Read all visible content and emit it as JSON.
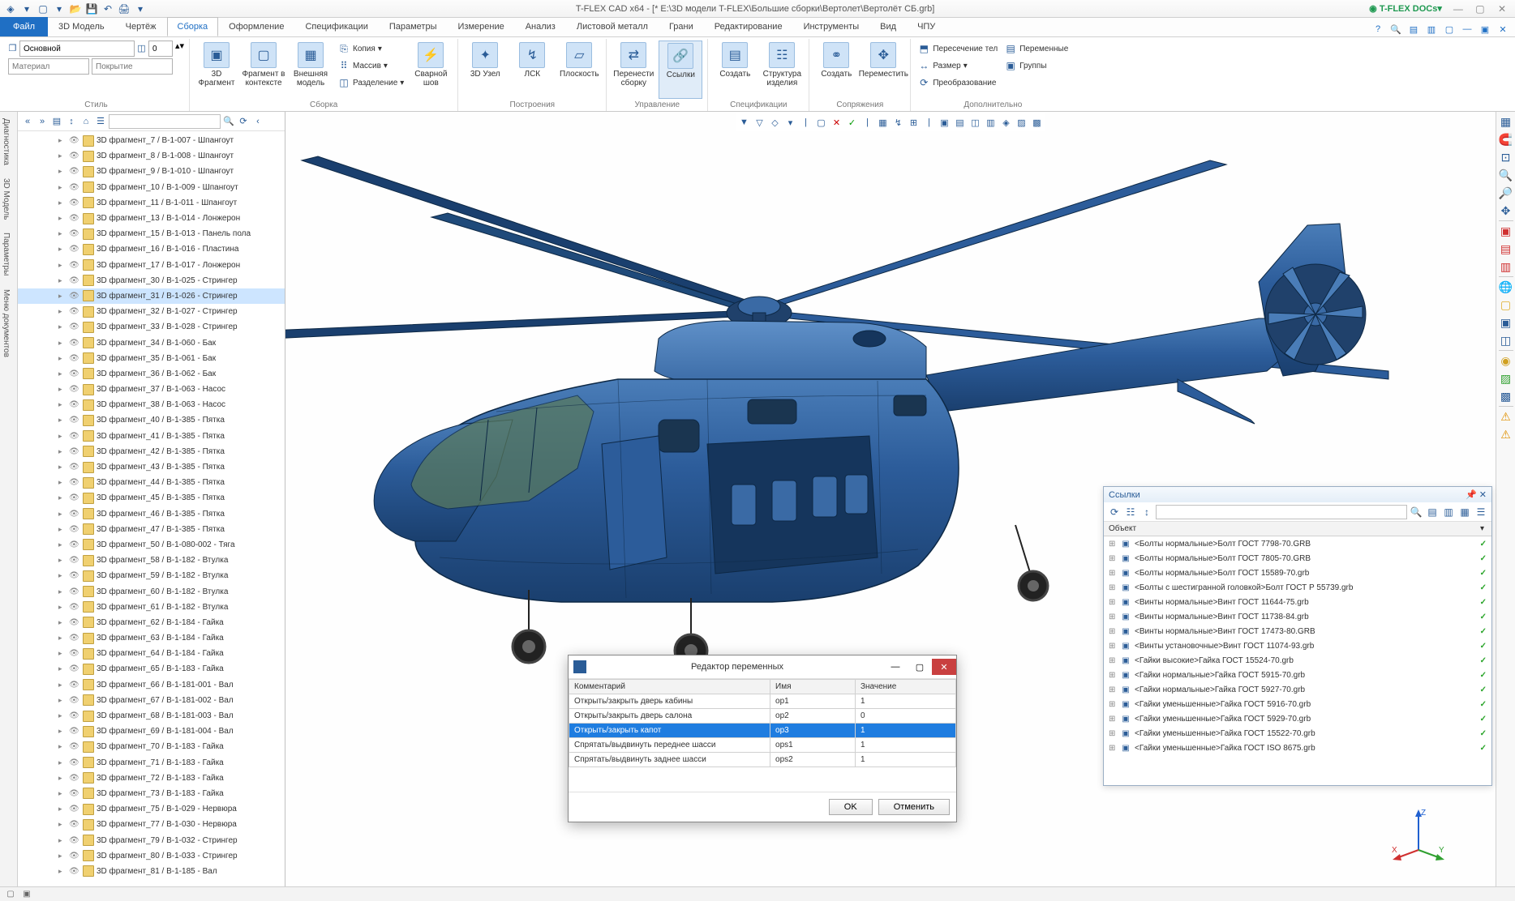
{
  "app": {
    "title": "T-FLEX CAD x64 - [* E:\\3D модели T-FLEX\\Большие сборки\\Вертолет\\Вертолёт СБ.grb]",
    "docs_link": "T-FLEX DOCs"
  },
  "ribbon_tabs": {
    "file": "Файл",
    "tabs": [
      "3D Модель",
      "Чертёж",
      "Сборка",
      "Оформление",
      "Спецификации",
      "Параметры",
      "Измерение",
      "Анализ",
      "Листовой металл",
      "Грани",
      "Редактирование",
      "Инструменты",
      "Вид",
      "ЧПУ"
    ],
    "active": "Сборка"
  },
  "ribbon": {
    "style": {
      "main_input": "Основной",
      "num_input": "0",
      "material": "Материал",
      "coating": "Покрытие",
      "title": "Стиль"
    },
    "groups": {
      "sborka": {
        "big": [
          {
            "label": "3D Фрагмент"
          },
          {
            "label": "Фрагмент в контексте"
          },
          {
            "label": "Внешняя модель"
          }
        ],
        "small": [
          "Копия",
          "Массив",
          "Разделение"
        ],
        "weld": "Сварной шов",
        "title": "Сборка"
      },
      "postroenia": {
        "big": [
          {
            "label": "3D Узел"
          },
          {
            "label": "ЛСК"
          },
          {
            "label": "Плоскость"
          }
        ],
        "title": "Построения"
      },
      "upravlenie": {
        "big": [
          {
            "label": "Перенести сборку"
          },
          {
            "label": "Ссылки"
          }
        ],
        "title": "Управление"
      },
      "spec": {
        "big": [
          {
            "label": "Создать"
          },
          {
            "label": "Структура изделия"
          }
        ],
        "title": "Спецификации"
      },
      "sopr": {
        "big": [
          {
            "label": "Создать"
          },
          {
            "label": "Переместить"
          }
        ],
        "title": "Сопряжения"
      },
      "dop": {
        "small": [
          "Пересечение тел",
          "Размер",
          "Преобразование",
          "Переменные",
          "Группы"
        ],
        "title": "Дополнительно"
      }
    }
  },
  "left_vtabs": [
    "Диагностика",
    "3D Модель",
    "Параметры",
    "Меню документов"
  ],
  "tree": [
    "3D фрагмент_7 / B-1-007 - Шпангоут",
    "3D фрагмент_8 / B-1-008 - Шпангоут",
    "3D фрагмент_9 / B-1-010 - Шпангоут",
    "3D фрагмент_10 / B-1-009 - Шпангоут",
    "3D фрагмент_11 / B-1-011 - Шпангоут",
    "3D фрагмент_13 / B-1-014 - Лонжерон",
    "3D фрагмент_15 / B-1-013 - Панель пола",
    "3D фрагмент_16 / B-1-016 - Пластина",
    "3D фрагмент_17 / B-1-017 - Лонжерон",
    "3D фрагмент_30 / B-1-025 - Стрингер",
    "3D фрагмент_31 / B-1-026 - Стрингер",
    "3D фрагмент_32 / B-1-027 - Стрингер",
    "3D фрагмент_33 / B-1-028 - Стрингер",
    "3D фрагмент_34 / B-1-060 - Бак",
    "3D фрагмент_35 / B-1-061 - Бак",
    "3D фрагмент_36 / B-1-062 - Бак",
    "3D фрагмент_37 / B-1-063 - Насос",
    "3D фрагмент_38 / B-1-063 - Насос",
    "3D фрагмент_40 / B-1-385 - Пятка",
    "3D фрагмент_41 / B-1-385 - Пятка",
    "3D фрагмент_42 / B-1-385 - Пятка",
    "3D фрагмент_43 / B-1-385 - Пятка",
    "3D фрагмент_44 / B-1-385 - Пятка",
    "3D фрагмент_45 / B-1-385 - Пятка",
    "3D фрагмент_46 / B-1-385 - Пятка",
    "3D фрагмент_47 / B-1-385 - Пятка",
    "3D фрагмент_50 / B-1-080-002 - Тяга",
    "3D фрагмент_58 / B-1-182 - Втулка",
    "3D фрагмент_59 / B-1-182 - Втулка",
    "3D фрагмент_60 / B-1-182 - Втулка",
    "3D фрагмент_61 / B-1-182 - Втулка",
    "3D фрагмент_62 / B-1-184 - Гайка",
    "3D фрагмент_63 / B-1-184 - Гайка",
    "3D фрагмент_64 / B-1-184 - Гайка",
    "3D фрагмент_65 / B-1-183 - Гайка",
    "3D фрагмент_66 / B-1-181-001 - Вал",
    "3D фрагмент_67 / B-1-181-002 - Вал",
    "3D фрагмент_68 / B-1-181-003 - Вал",
    "3D фрагмент_69 / B-1-181-004 - Вал",
    "3D фрагмент_70 / B-1-183 - Гайка",
    "3D фрагмент_71 / B-1-183 - Гайка",
    "3D фрагмент_72 / B-1-183 - Гайка",
    "3D фрагмент_73 / B-1-183 - Гайка",
    "3D фрагмент_75 / B-1-029 - Нервюра",
    "3D фрагмент_77 / B-1-030 - Нервюра",
    "3D фрагмент_79 / B-1-032 - Стрингер",
    "3D фрагмент_80 / B-1-033 - Стрингер",
    "3D фрагмент_81 / B-1-185 - Вал"
  ],
  "tree_selected_index": 10,
  "links_panel": {
    "title": "Ссылки",
    "header": "Объект",
    "items": [
      "<Болты нормальные>Болт ГОСТ 7798-70.GRB",
      "<Болты нормальные>Болт ГОСТ 7805-70.GRB",
      "<Болты нормальные>Болт ГОСТ 15589-70.grb",
      "<Болты с шестигранной головкой>Болт ГОСТ Р 55739.grb",
      "<Винты нормальные>Винт ГОСТ 11644-75.grb",
      "<Винты нормальные>Винт ГОСТ 11738-84.grb",
      "<Винты нормальные>Винт ГОСТ 17473-80.GRB",
      "<Винты установочные>Винт ГОСТ 11074-93.grb",
      "<Гайки высокие>Гайка ГОСТ 15524-70.grb",
      "<Гайки нормальные>Гайка ГОСТ 5915-70.grb",
      "<Гайки нормальные>Гайка ГОСТ 5927-70.grb",
      "<Гайки уменьшенные>Гайка ГОСТ 5916-70.grb",
      "<Гайки уменьшенные>Гайка ГОСТ 5929-70.grb",
      "<Гайки уменьшенные>Гайка ГОСТ 15522-70.grb",
      "<Гайки уменьшенные>Гайка ГОСТ ISO 8675.grb"
    ]
  },
  "var_dialog": {
    "title": "Редактор переменных",
    "cols": [
      "Комментарий",
      "Имя",
      "Значение"
    ],
    "rows": [
      {
        "c": "Открыть/закрыть дверь кабины",
        "n": "op1",
        "v": "1"
      },
      {
        "c": "Открыть/закрыть дверь салона",
        "n": "op2",
        "v": "0"
      },
      {
        "c": "Открыть/закрыть капот",
        "n": "op3",
        "v": "1"
      },
      {
        "c": "Спрятать/выдвинуть переднее шасси",
        "n": "ops1",
        "v": "1"
      },
      {
        "c": "Спрятать/выдвинуть заднее шасси",
        "n": "ops2",
        "v": "1"
      }
    ],
    "selected_row": 2,
    "ok": "OK",
    "cancel": "Отменить"
  }
}
